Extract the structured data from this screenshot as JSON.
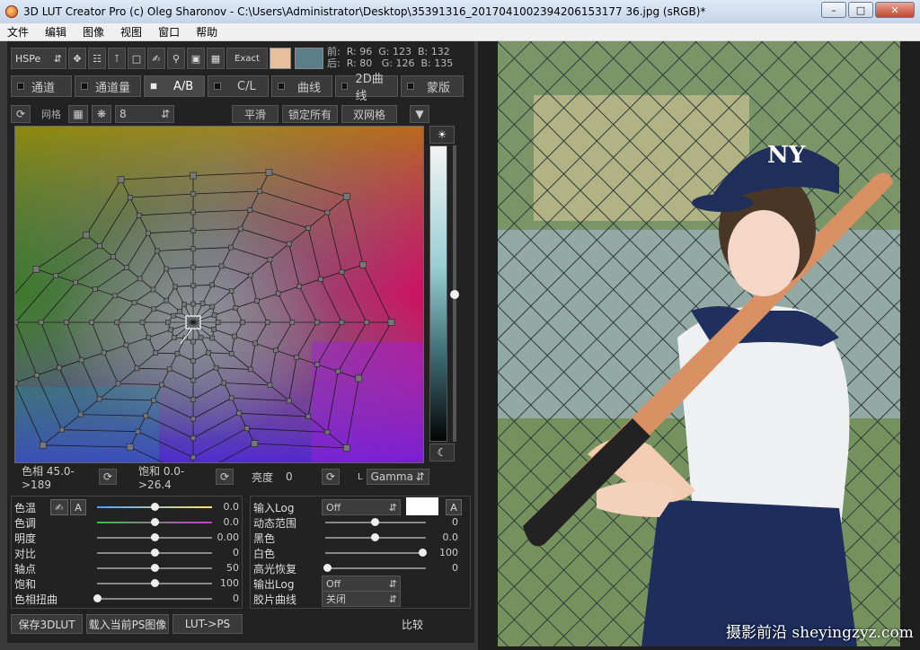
{
  "window": {
    "title": "3D LUT Creator Pro (c) Oleg Sharonov - C:\\Users\\Administrator\\Desktop\\35391316_2017041002394206153177 36.jpg (sRGB)*"
  },
  "menu": [
    "文件",
    "编辑",
    "图像",
    "视图",
    "窗口",
    "帮助"
  ],
  "toolbar": {
    "color_model": "HSPe",
    "exact_label": "Exact"
  },
  "readout": {
    "before_label": "前:",
    "after_label": "后:",
    "before": {
      "r": "R: 96",
      "g": "G: 123",
      "b": "B: 132"
    },
    "after": {
      "r": "R: 80",
      "g": "G: 126",
      "b": "B: 135"
    }
  },
  "tabs": [
    "通道",
    "通道量",
    "A/B",
    "C/L",
    "曲线",
    "2D曲线",
    "蒙版"
  ],
  "grid_row": {
    "grid_label": "网格",
    "grid_value": "8",
    "smooth_label": "平滑",
    "lock_all_label": "锁定所有",
    "double_grid_label": "双网格"
  },
  "status_row": {
    "hue": "色相 45.0->189",
    "saturation": "饱和 0.0->26.4",
    "brightness_label": "亮度",
    "brightness_value": "0",
    "l_label": "L",
    "gamma_option": "Gamma"
  },
  "sliders_left": [
    {
      "label": "色温",
      "value": "0.0",
      "pos": 0.5
    },
    {
      "label": "色调",
      "value": "0.0",
      "pos": 0.5
    },
    {
      "label": "明度",
      "value": "0.00",
      "pos": 0.5
    },
    {
      "label": "对比",
      "value": "0",
      "pos": 0.5
    },
    {
      "label": "轴点",
      "value": "50",
      "pos": 0.5
    },
    {
      "label": "饱和",
      "value": "100",
      "pos": 0.5
    },
    {
      "label": "色相扭曲",
      "value": "0",
      "pos": 0.0
    }
  ],
  "auto_label": "A",
  "sliders_right": {
    "input_log_label": "输入Log",
    "input_log_value": "Off",
    "dynamic_range_label": "动态范围",
    "dynamic_range_value": "0",
    "black_label": "黑色",
    "black_value": "0.0",
    "white_label": "白色",
    "white_value": "100",
    "highlight_label": "高光恢复",
    "highlight_value": "0",
    "output_log_label": "输出Log",
    "output_log_value": "Off",
    "film_curve_label": "胶片曲线",
    "film_curve_value": "关闭"
  },
  "bottom_buttons": {
    "save": "保存3DLUT",
    "load_ps": "载入当前PS图像",
    "lut_ps": "LUT->PS",
    "compare": "比较"
  },
  "colors": {
    "swatch_before": "#e8c09e",
    "swatch_after": "#5b7f8a"
  },
  "watermark": "摄影前沿 sheyingzyz.com"
}
